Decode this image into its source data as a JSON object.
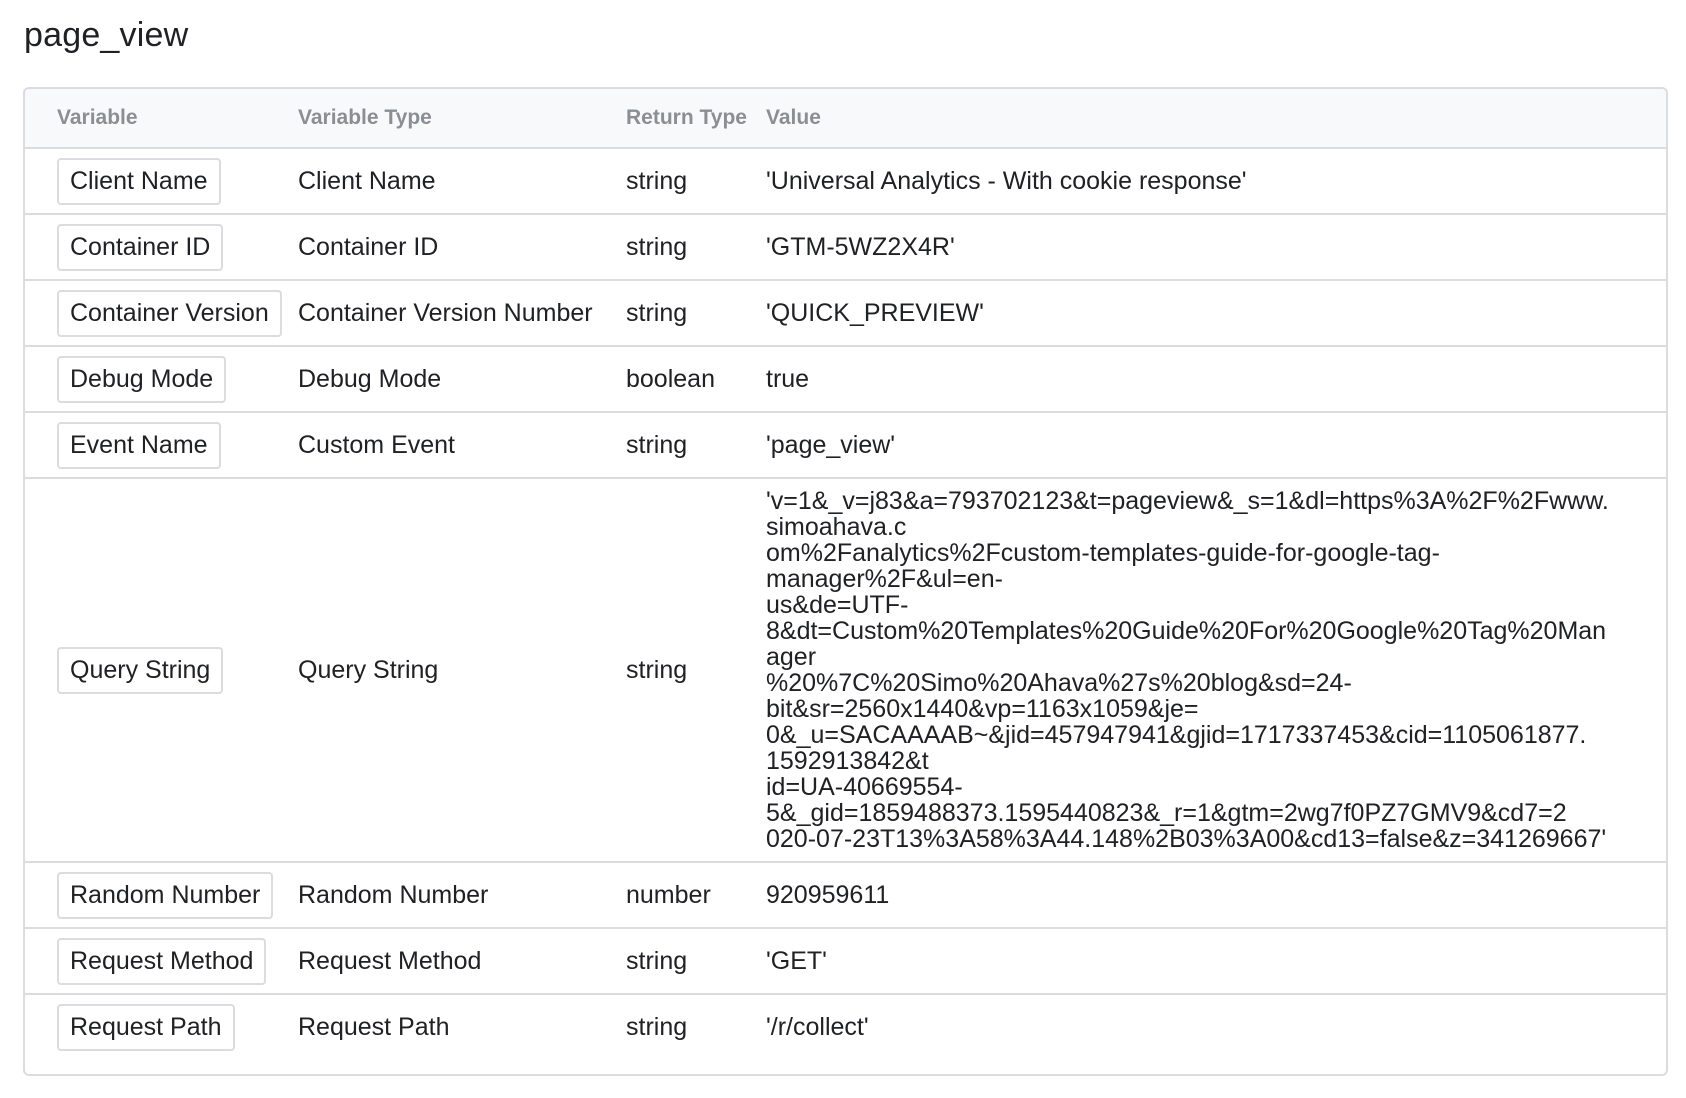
{
  "event_title": "page_view",
  "table": {
    "headers": [
      "Variable",
      "Variable Type",
      "Return Type",
      "Value"
    ],
    "rows": [
      {
        "variable": "Client Name",
        "variable_type": "Client Name",
        "return_type": "string",
        "value": "'Universal Analytics - With cookie response'"
      },
      {
        "variable": "Container ID",
        "variable_type": "Container ID",
        "return_type": "string",
        "value": "'GTM-5WZ2X4R'"
      },
      {
        "variable": "Container Version",
        "variable_type": "Container Version Number",
        "return_type": "string",
        "value": "'QUICK_PREVIEW'"
      },
      {
        "variable": "Debug Mode",
        "variable_type": "Debug Mode",
        "return_type": "boolean",
        "value": "true"
      },
      {
        "variable": "Event Name",
        "variable_type": "Custom Event",
        "return_type": "string",
        "value": "'page_view'"
      },
      {
        "variable": "Query String",
        "variable_type": "Query String",
        "return_type": "string",
        "value": "'v=1&_v=j83&a=793702123&t=pageview&_s=1&dl=https%3A%2F%2Fwww.\nsimoahava.c\nom%2Fanalytics%2Fcustom-templates-guide-for-google-tag-\nmanager%2F&ul=en-\nus&de=UTF-\n8&dt=Custom%20Templates%20Guide%20For%20Google%20Tag%20Man\nager\n%20%7C%20Simo%20Ahava%27s%20blog&sd=24-\nbit&sr=2560x1440&vp=1163x1059&je=\n0&_u=SACAAAAB~&jid=457947941&gjid=1717337453&cid=1105061877.\n1592913842&t\nid=UA-40669554-\n5&_gid=1859488373.1595440823&_r=1&gtm=2wg7f0PZ7GMV9&cd7=2\n020-07-23T13%3A58%3A44.148%2B03%3A00&cd13=false&z=341269667'"
      },
      {
        "variable": "Random Number",
        "variable_type": "Random Number",
        "return_type": "number",
        "value": "920959611"
      },
      {
        "variable": "Request Method",
        "variable_type": "Request Method",
        "return_type": "string",
        "value": "'GET'"
      },
      {
        "variable": "Request Path",
        "variable_type": "Request Path",
        "return_type": "string",
        "value": "'/r/collect'"
      }
    ]
  }
}
